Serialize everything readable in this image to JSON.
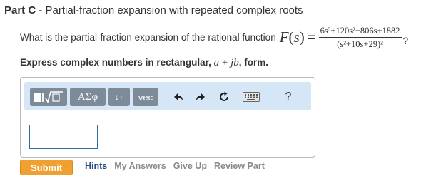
{
  "part": {
    "label": "Part C",
    "separator": " - ",
    "title": "Partial-fraction expansion with repeated complex roots"
  },
  "question": {
    "text": "What is the partial-fraction expansion of the rational function",
    "function_name": "F",
    "function_var": "s",
    "numerator": "6s³+120s²+806s+1882",
    "denominator": "(s²+10s+29)²",
    "end": "?"
  },
  "instruction": {
    "text": "Express complex numbers in rectangular, ",
    "math_a": "a",
    "math_plus": " + ",
    "math_jb": "jb",
    "end": ", form."
  },
  "toolbar": {
    "template_label": "■√□",
    "symbols_label": "ΑΣφ",
    "arrows_label": "↓↑",
    "vec_label": "vec",
    "undo_icon": "undo-icon",
    "redo_icon": "redo-icon",
    "reset_icon": "reset-icon",
    "keyboard_icon": "keyboard-icon",
    "help_label": "?"
  },
  "answer": {
    "value": ""
  },
  "actions": {
    "submit_label": "Submit",
    "hints_label": "Hints",
    "my_answers_label": "My Answers",
    "give_up_label": "Give Up",
    "review_part_label": "Review Part"
  },
  "colors": {
    "submit": "#f0a030",
    "toolbar_bg": "#d5e6f7",
    "toolbar_button": "#7d8b98",
    "hints_link": "#2a4e7f"
  }
}
